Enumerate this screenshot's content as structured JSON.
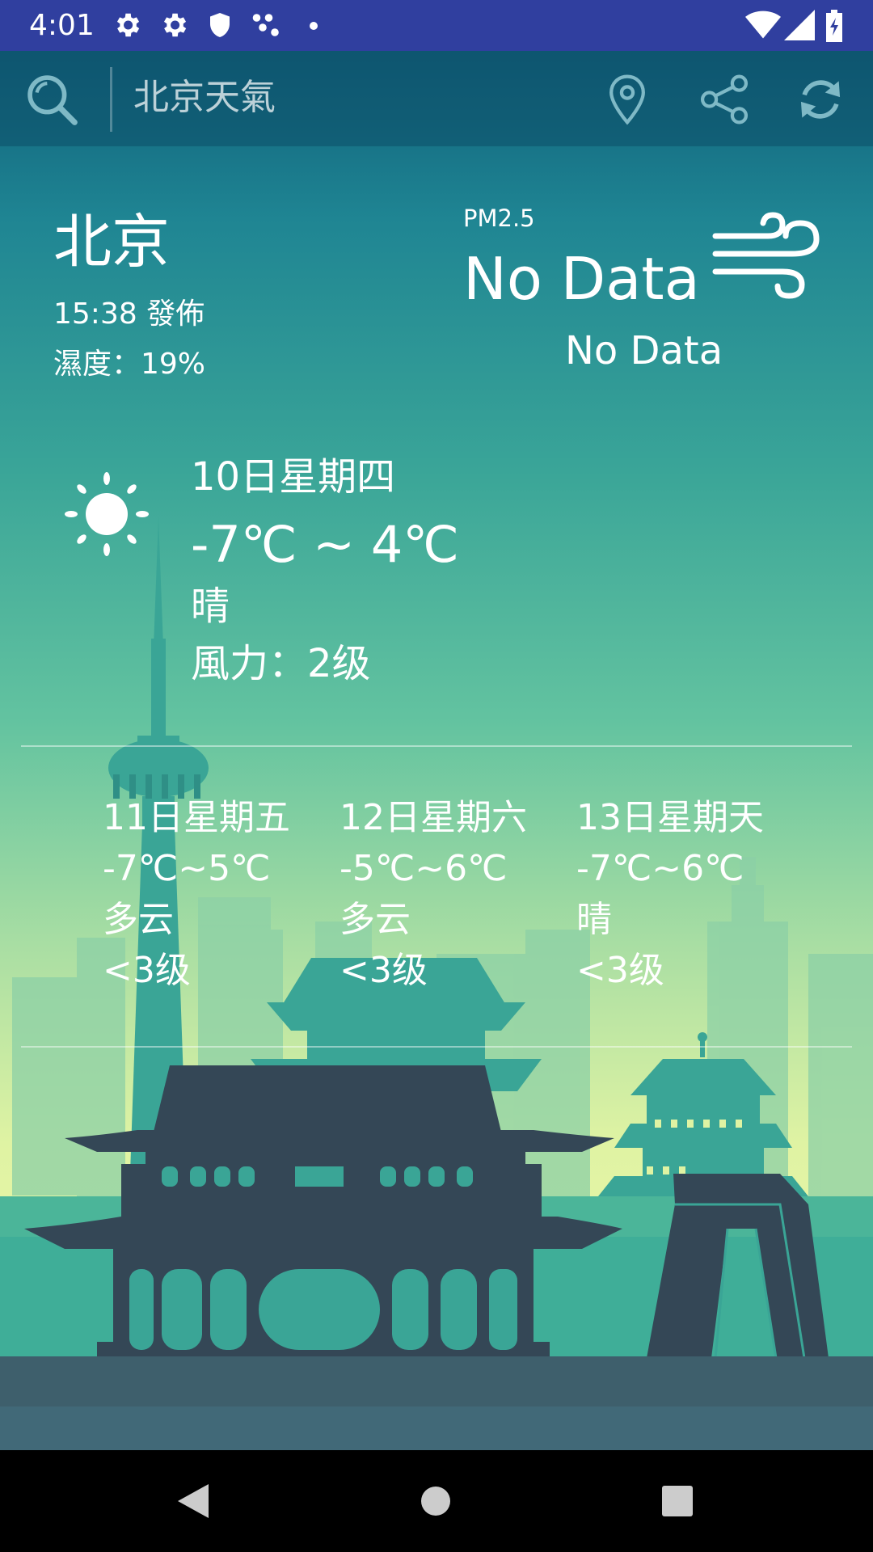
{
  "status_bar": {
    "time": "4:01",
    "icons": [
      "gear-icon",
      "gear-icon",
      "shield-icon",
      "dots-icon",
      "dot-icon",
      "wifi-icon",
      "signal-icon",
      "battery-icon"
    ]
  },
  "toolbar": {
    "title": "北京天氣",
    "icons": [
      "search-icon",
      "location-pin-icon",
      "share-icon",
      "refresh-icon"
    ]
  },
  "current": {
    "city": "北京",
    "publish_time": "15:38 發佈",
    "humidity": "濕度：19%",
    "pm_label": "PM2.5",
    "pm_value": "No Data",
    "pm_quality": "No Data",
    "wind_icon": "wind-icon"
  },
  "today": {
    "icon": "sun-icon",
    "date": "10日星期四",
    "temp": "-7℃ ~ 4℃",
    "condition": "晴",
    "wind": "風力：2级"
  },
  "forecast": [
    {
      "date": "11日星期五",
      "temp": "-7℃~5℃",
      "condition": "多云",
      "wind": "<3级"
    },
    {
      "date": "12日星期六",
      "temp": "-5℃~6℃",
      "condition": "多云",
      "wind": "<3级"
    },
    {
      "date": "13日星期天",
      "temp": "-7℃~6℃",
      "condition": "晴",
      "wind": "<3级"
    }
  ],
  "nav_bar": {
    "icons": [
      "back-icon",
      "home-icon",
      "recents-icon"
    ]
  },
  "colors": {
    "status_bar": "#303F9F",
    "building_dark": "#344756",
    "building_teal": "#3aa596",
    "ground": "#3e5f6c"
  }
}
